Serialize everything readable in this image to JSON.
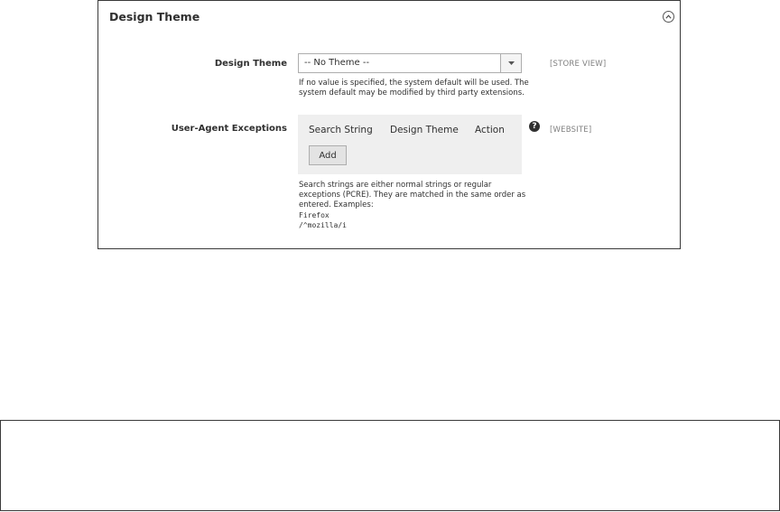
{
  "section": {
    "title": "Design Theme"
  },
  "design_theme": {
    "label": "Design Theme",
    "selected_value": "-- No Theme --",
    "scope": "[STORE VIEW]",
    "note_line1": "If no value is specified, the system default will be used. The",
    "note_line2": "system default may be modified by third party extensions."
  },
  "user_agent": {
    "label": "User-Agent Exceptions",
    "columns": [
      "Search String",
      "Design Theme",
      "Action"
    ],
    "add_label": "Add",
    "help_glyph": "?",
    "scope": "[WEBSITE]",
    "note_line1": "Search strings are either normal strings or regular",
    "note_line2": "exceptions (PCRE). They are matched in the same order as",
    "note_line3": "entered. Examples:",
    "example1": "Firefox",
    "example2": "/^mozilla/i"
  },
  "icons": {
    "collapse": "chevron-up-circle-icon",
    "dropdown": "triangle-down-icon",
    "help": "question-circle-icon"
  },
  "colors": {
    "panel_border": "#3a3a3a",
    "grid_background": "#efefef",
    "scope_text": "#808080",
    "text": "#303030"
  }
}
